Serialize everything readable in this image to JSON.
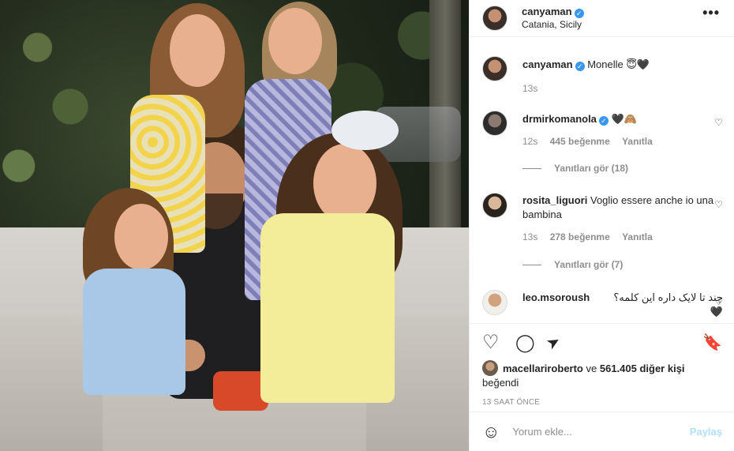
{
  "post": {
    "username": "canyaman",
    "location": "Catania, Sicily"
  },
  "caption": {
    "username": "canyaman",
    "text": "Monelle 😇🖤",
    "time": "13s"
  },
  "comments": [
    {
      "username": "drmirkomanola",
      "verified": true,
      "text": "🖤🙈",
      "time": "12s",
      "likes": "445 beğenme",
      "reply": "Yanıtla",
      "view_replies": "Yanıtları gör (18)"
    },
    {
      "username": "rosita_liguori",
      "verified": false,
      "text": "Voglio essere anche io una bambina",
      "time": "13s",
      "likes": "278 beğenme",
      "reply": "Yanıtla",
      "view_replies": "Yanıtları gör (7)"
    },
    {
      "username": "leo.msoroush",
      "verified": false,
      "text": "چند تا لایک داره این کلمه؟🖤"
    }
  ],
  "likes": {
    "first_user": "macellariroberto",
    "connector": "ve",
    "others": "561.405 diğer kişi",
    "suffix": "beğendi"
  },
  "timestamp": "13 SAAT ÖNCE",
  "add_comment": {
    "placeholder": "Yorum ekle...",
    "post_label": "Paylaş"
  },
  "icons": {
    "more": "•••",
    "verified": "✓",
    "heart": "♡",
    "comment": "◯",
    "share": "➤",
    "save": "🔖",
    "emoji": "☺"
  },
  "colors": {
    "verified": "#3897f0",
    "post_button_disabled": "#b2dffc",
    "muted_text": "#8e8e8e"
  }
}
